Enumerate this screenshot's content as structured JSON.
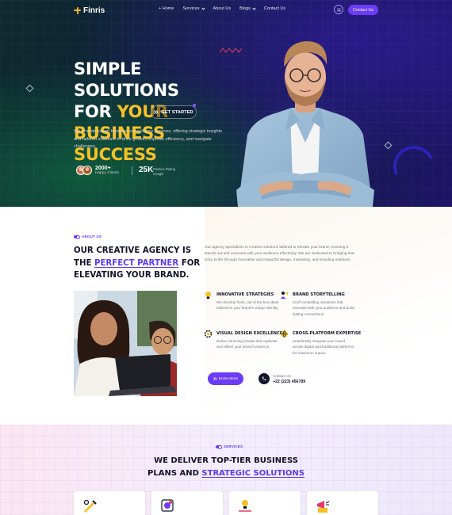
{
  "brand": {
    "name": "Finris"
  },
  "nav": {
    "items": [
      {
        "label": "+ Home",
        "has_dropdown": false
      },
      {
        "label": "Services",
        "has_dropdown": true
      },
      {
        "label": "About Us",
        "has_dropdown": false
      },
      {
        "label": "Blogs",
        "has_dropdown": true
      },
      {
        "label": "Contact Us",
        "has_dropdown": false
      }
    ],
    "grid_icon": "grid-dots-icon",
    "contact_button": "Contact Us"
  },
  "hero": {
    "title_line1": "SIMPLE SOLUTIONS",
    "title_line2_a": "FOR ",
    "title_line2_b": "YOUR BUSINESS",
    "title_line3": "SUCCESS",
    "cta": "GET STARTED",
    "cta_icon": "double-chevron-right-icon",
    "description": "We provide expert business consultancy services, offering strategic insights and tailored solutions to drive growth, improve efficiency, and navigate challenges.",
    "stat1": {
      "value": "2000+",
      "label": "Happy Clients"
    },
    "stat2": {
      "value": "25K",
      "label_line1": "Positive Rating",
      "label_line2": "Google"
    }
  },
  "about": {
    "tag": "About Us",
    "title_a": "OUR CREATIVE AGENCY IS THE ",
    "title_highlight": "PERFECT PARTNER",
    "title_b": " FOR ELEVATING YOUR BRAND.",
    "description": "Our agency specializes in creative solutions tailored to elevate your brand, ensuring it stands out and connects with your audience effectively. We are dedicated to bringing that story to life through innovative and impactful design, marketing, and branding solutions.",
    "features": [
      {
        "title": "INNOVATIVE STRATEGIES",
        "desc": "We develop fresh, out of the box ideas tailored to your brand's unique identity.",
        "icon": "lightbulb-strategy-icon"
      },
      {
        "title": "BRAND STORYTELLING",
        "desc": "Craft compelling narratives that resonate with your audience and build lasting connections.",
        "icon": "megaphone-person-icon"
      },
      {
        "title": "VISUAL DESIGN EXCELLENCE",
        "desc": "Deliver stunning visuals that captivate and reflect your brand's essence.",
        "icon": "design-gear-icon"
      },
      {
        "title": "CROSS-PLATFORM EXPERTISE",
        "desc": "Seamlessly integrate your brand across digital and traditional platforms for maximum impact.",
        "icon": "platform-globe-icon"
      }
    ],
    "cta": "Know More",
    "contact_label": "Contact Us",
    "contact_phone": "+22 (223) 456789",
    "phone_icon": "phone-icon"
  },
  "services": {
    "tag": "Services",
    "title_line1": "WE DELIVER TOP-TIER BUSINESS",
    "title_line2_a": "PLANS AND ",
    "title_line2_b": "STRATEGIC SOLUTIONS",
    "cards": [
      {
        "icon": "tools-pen-icon"
      },
      {
        "icon": "design-tablet-icon"
      },
      {
        "icon": "idea-presentation-icon"
      },
      {
        "icon": "megaphone-box-icon"
      }
    ]
  },
  "colors": {
    "accent": "#6c3bf5",
    "highlight_yellow": "#f6c026",
    "heading": "#14142b",
    "body_text": "#707285"
  }
}
